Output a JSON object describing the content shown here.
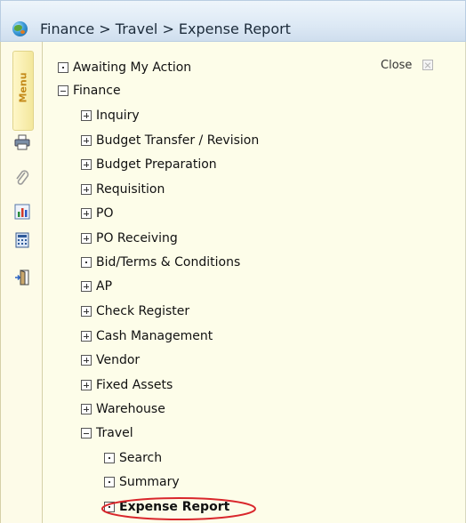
{
  "header": {
    "breadcrumb": "Finance > Travel > Expense Report",
    "icon": "globe-icon"
  },
  "sidebar": {
    "menu_label": "Menu",
    "icons": [
      "printer-icon",
      "paperclip-icon",
      "chart-icon",
      "calculator-icon",
      "exit-door-icon"
    ]
  },
  "panel": {
    "close_label": "Close"
  },
  "tree": {
    "awaiting": "Awaiting My Action",
    "finance": "Finance",
    "inquiry": "Inquiry",
    "budget_transfer": "Budget Transfer / Revision",
    "budget_prep": "Budget Preparation",
    "requisition": "Requisition",
    "po": "PO",
    "po_receiving": "PO Receiving",
    "bid_terms": "Bid/Terms & Conditions",
    "ap": "AP",
    "check_register": "Check Register",
    "cash_mgmt": "Cash Management",
    "vendor": "Vendor",
    "fixed_assets": "Fixed Assets",
    "warehouse": "Warehouse",
    "travel": "Travel",
    "search": "Search",
    "summary": "Summary",
    "expense_report": "Expense Report"
  },
  "colors": {
    "highlight_ring": "#d9262b",
    "panel_bg": "#fdfde9",
    "titlebar_bg": "#dde9f5"
  }
}
